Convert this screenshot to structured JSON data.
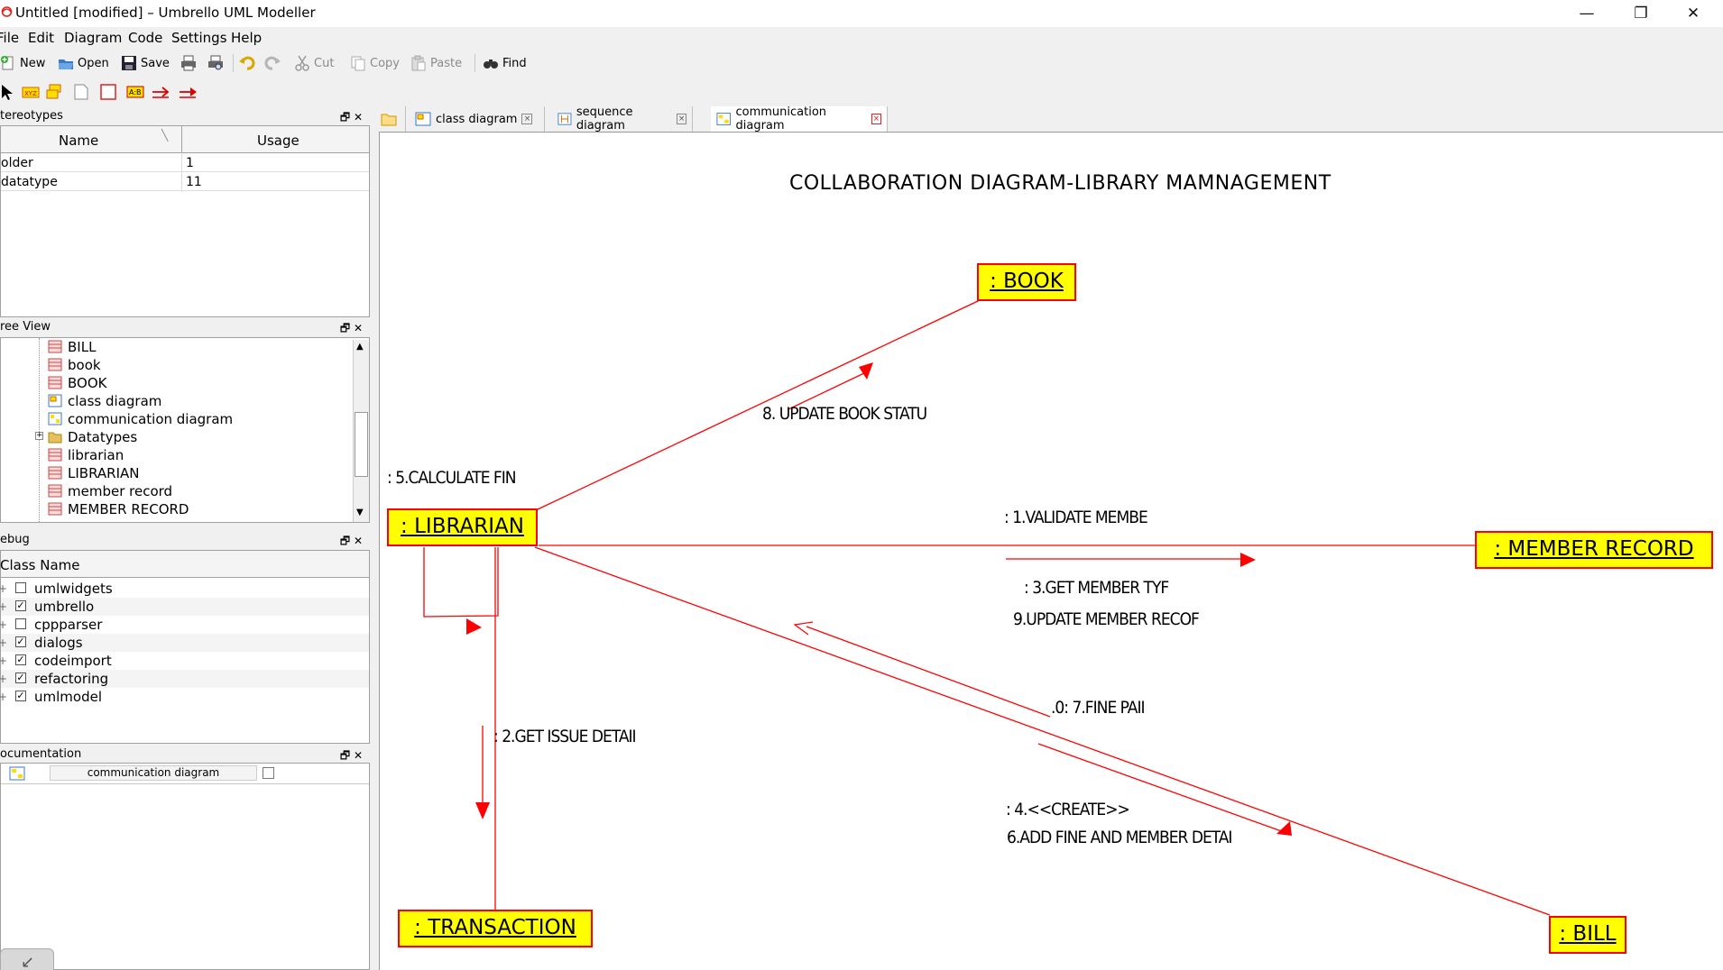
{
  "window": {
    "title": "Untitled [modified] – Umbrello UML Modeller",
    "buttons": {
      "minimize": "—",
      "maximize": "❐",
      "close": "✕"
    }
  },
  "menu": [
    "File",
    "Edit",
    "Diagram",
    "Code",
    "Settings",
    "Help"
  ],
  "toolbar": {
    "new": "New",
    "open": "Open",
    "save": "Save",
    "cut": "Cut",
    "copy": "Copy",
    "paste": "Paste",
    "find": "Find"
  },
  "stereotypes": {
    "title": "tereotypes",
    "col_name": "Name",
    "col_usage": "Usage",
    "rows": [
      {
        "name": "older",
        "usage": "1"
      },
      {
        "name": "datatype",
        "usage": "11"
      }
    ]
  },
  "tree_view": {
    "title": "ree View",
    "items": [
      {
        "label": "BILL",
        "icon": "class-icon"
      },
      {
        "label": "book",
        "icon": "class-icon"
      },
      {
        "label": "BOOK",
        "icon": "class-icon"
      },
      {
        "label": "class diagram",
        "icon": "class-diagram-icon"
      },
      {
        "label": "communication diagram",
        "icon": "communication-diagram-icon"
      },
      {
        "label": "Datatypes",
        "icon": "folder-icon"
      },
      {
        "label": "librarian",
        "icon": "class-icon"
      },
      {
        "label": "LIBRARIAN",
        "icon": "class-icon"
      },
      {
        "label": "member record",
        "icon": "class-icon"
      },
      {
        "label": "MEMBER RECORD",
        "icon": "class-icon"
      }
    ]
  },
  "debug": {
    "title": "ebug",
    "col": "Class Name",
    "rows": [
      {
        "label": "umlwidgets",
        "checked": false
      },
      {
        "label": "umbrello",
        "checked": true
      },
      {
        "label": "cppparser",
        "checked": false
      },
      {
        "label": "dialogs",
        "checked": true
      },
      {
        "label": "codeimport",
        "checked": true
      },
      {
        "label": "refactoring",
        "checked": true
      },
      {
        "label": "umlmodel",
        "checked": true
      }
    ]
  },
  "documentation": {
    "title": "ocumentation",
    "diagram_name": "communication diagram"
  },
  "tabs": [
    {
      "label": "class diagram",
      "active": false
    },
    {
      "label": "sequence diagram",
      "active": false
    },
    {
      "label": "communication diagram",
      "active": true
    }
  ],
  "diagram": {
    "title": "COLLABORATION DIAGRAM-LIBRARY MAMNAGEMENT",
    "objects": {
      "book": ": BOOK",
      "librarian": ": LIBRARIAN",
      "member_record": ": MEMBER RECORD",
      "transaction": ": TRANSACTION",
      "bill": ": BILL"
    },
    "messages": {
      "m8": "8. UPDATE BOOK STATU",
      "m5": ": 5.CALCULATE FIN",
      "m1": ": 1.VALIDATE MEMBE",
      "m3": ": 3.GET MEMBER TYF",
      "m9": "9.UPDATE MEMBER RECOF",
      "m7": ".0: 7.FINE PAII",
      "m2": ": 2.GET ISSUE DETAII",
      "m4": ": 4.<<CREATE>>",
      "m6": "6.ADD FINE AND MEMBER DETAI"
    },
    "colors": {
      "object_fill": "#ffff00",
      "line": "#ff0000"
    }
  }
}
